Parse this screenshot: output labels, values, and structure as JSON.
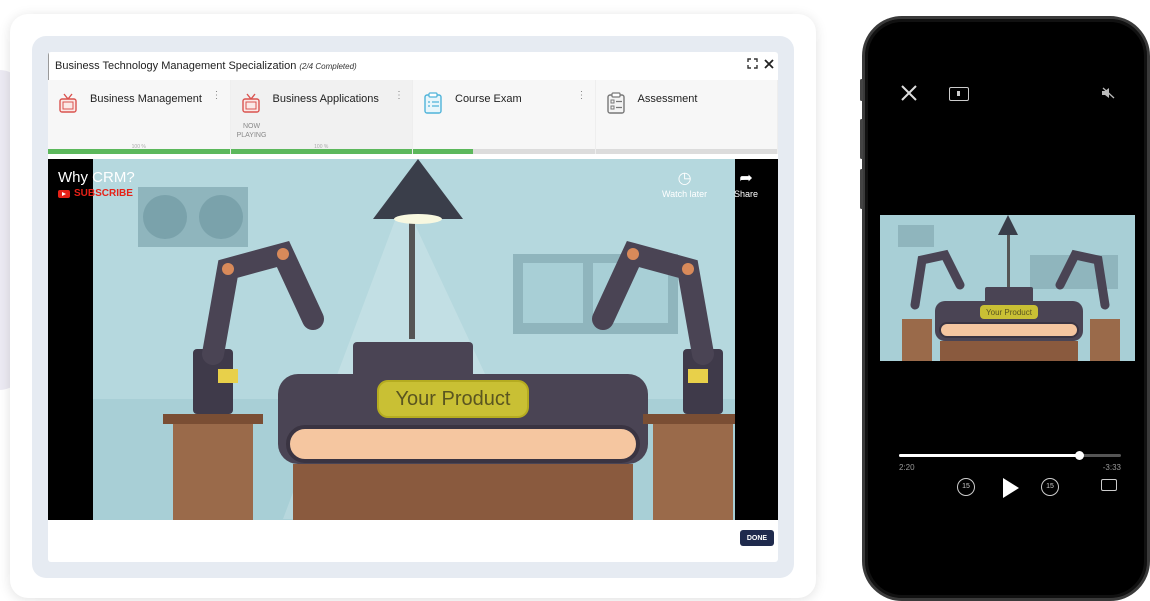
{
  "course": {
    "title": "Business Technology Management Specialization",
    "progress_note": "(2/4 Completed)"
  },
  "header_icons": {
    "expand": "expand-icon",
    "close": "close-icon"
  },
  "tabs": [
    {
      "label": "Business Management",
      "icon": "tv-icon",
      "progress": 1.0,
      "pct_label": "100 %",
      "status": ""
    },
    {
      "label": "Business Applications",
      "icon": "tv-icon",
      "progress": 1.0,
      "pct_label": "100 %",
      "status": "NOW PLAYING"
    },
    {
      "label": "Course Exam",
      "icon": "clipboard-icon",
      "progress": 0.5,
      "pct_label": "",
      "status": ""
    },
    {
      "label": "Assessment",
      "icon": "clipboard-icon",
      "progress": 0.0,
      "pct_label": "",
      "status": ""
    }
  ],
  "video": {
    "title": "Why CRM?",
    "subscribe": "SUBSCRIBE",
    "watch_later": "Watch later",
    "share": "Share",
    "product_label": "Your Product"
  },
  "done_label": "DONE",
  "phone": {
    "product_label": "Your Product",
    "elapsed": "2:20",
    "remaining": "-3:33",
    "progress": 0.81,
    "skip_back": "15",
    "skip_fwd": "15"
  },
  "colors": {
    "progress_fill": "#5cb85c",
    "done_button": "#1f2a4d",
    "subscribe_red": "#e62117",
    "product_yellow": "#c9c034"
  }
}
